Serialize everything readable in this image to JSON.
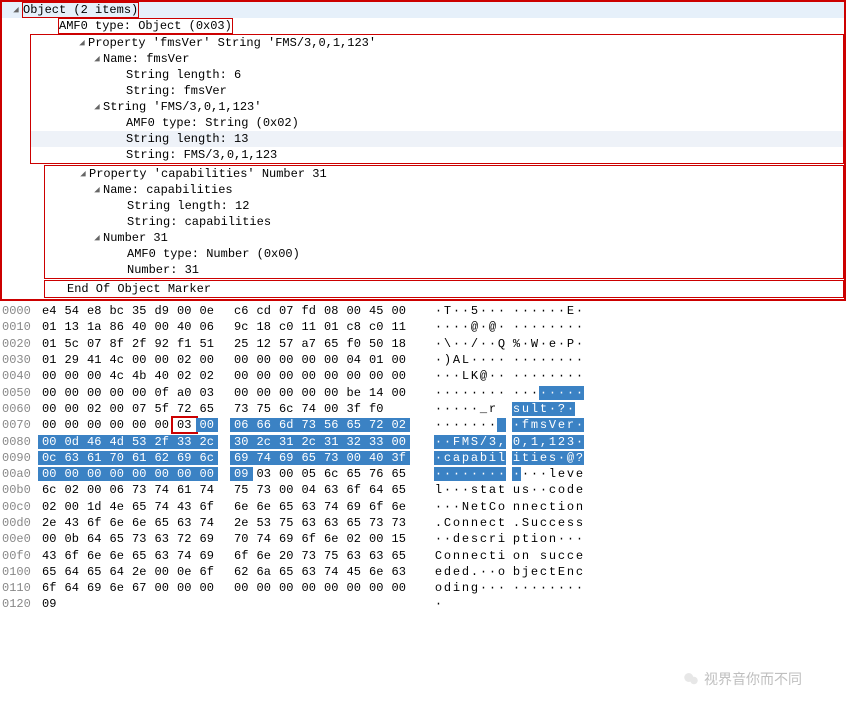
{
  "tree": {
    "root": {
      "label": "Object (2 items)"
    },
    "amf0": {
      "label": "AMF0 type: Object (0x03)"
    },
    "p1": {
      "label": "Property 'fmsVer' String 'FMS/3,0,1,123'",
      "name": {
        "label": "Name: fmsVer",
        "len": "String length: 6",
        "str": "String: fmsVer"
      },
      "val": {
        "label": "String 'FMS/3,0,1,123'",
        "type": "AMF0 type: String (0x02)",
        "len": "String length: 13",
        "str": "String: FMS/3,0,1,123"
      }
    },
    "p2": {
      "label": "Property 'capabilities' Number 31",
      "name": {
        "label": "Name: capabilities",
        "len": "String length: 12",
        "str": "String: capabilities"
      },
      "val": {
        "label": "Number 31",
        "type": "AMF0 type: Number (0x00)",
        "num": "Number: 31"
      }
    },
    "end": {
      "label": "End Of Object Marker"
    }
  },
  "hex": {
    "rows": [
      {
        "off": "0000",
        "b": [
          "e4",
          "54",
          "e8",
          "bc",
          "35",
          "d9",
          "00",
          "0e",
          "c6",
          "cd",
          "07",
          "fd",
          "08",
          "00",
          "45",
          "00"
        ],
        "a": "·T··5··· ······E·"
      },
      {
        "off": "0010",
        "b": [
          "01",
          "13",
          "1a",
          "86",
          "40",
          "00",
          "40",
          "06",
          "9c",
          "18",
          "c0",
          "11",
          "01",
          "c8",
          "c0",
          "11"
        ],
        "a": "····@·@· ········"
      },
      {
        "off": "0020",
        "b": [
          "01",
          "5c",
          "07",
          "8f",
          "2f",
          "92",
          "f1",
          "51",
          "25",
          "12",
          "57",
          "a7",
          "65",
          "f0",
          "50",
          "18"
        ],
        "a": "·\\··/··Q %·W·e·P·"
      },
      {
        "off": "0030",
        "b": [
          "01",
          "29",
          "41",
          "4c",
          "00",
          "00",
          "02",
          "00",
          "00",
          "00",
          "00",
          "00",
          "00",
          "04",
          "01",
          "00"
        ],
        "a": "·)AL···· ········"
      },
      {
        "off": "0040",
        "b": [
          "00",
          "00",
          "00",
          "4c",
          "4b",
          "40",
          "02",
          "02",
          "00",
          "00",
          "00",
          "00",
          "00",
          "00",
          "00",
          "00"
        ],
        "a": "···LK@·· ········"
      },
      {
        "off": "0050",
        "b": [
          "00",
          "00",
          "00",
          "00",
          "00",
          "0f",
          "a0",
          "03",
          "00",
          "00",
          "00",
          "00",
          "00",
          "be",
          "14",
          "00"
        ],
        "a": "········ ········",
        "sel_a": [
          [
            11,
            15
          ]
        ]
      },
      {
        "off": "0060",
        "b": [
          "00",
          "00",
          "02",
          "00",
          "07",
          "5f",
          "72",
          "65",
          "73",
          "75",
          "6c",
          "74",
          "00",
          "3f",
          "f0"
        ],
        "a": "·····_r esult·?·",
        "sel_a": [
          [
            8,
            15
          ]
        ]
      },
      {
        "off": "0070",
        "b": [
          "00",
          "00",
          "00",
          "00",
          "00",
          "00",
          "03",
          "00",
          "06",
          "66",
          "6d",
          "73",
          "56",
          "65",
          "72",
          "02"
        ],
        "box": 6,
        "sel": [
          [
            7,
            15
          ]
        ],
        "a": "·······  ·fmsVer·",
        "sel_a": [
          [
            7,
            15
          ]
        ]
      },
      {
        "off": "0080",
        "b": [
          "00",
          "0d",
          "46",
          "4d",
          "53",
          "2f",
          "33",
          "2c",
          "30",
          "2c",
          "31",
          "2c",
          "31",
          "32",
          "33",
          "00"
        ],
        "sel": [
          [
            0,
            15
          ]
        ],
        "a": "··FMS/3, 0,1,123·",
        "sel_a": [
          [
            0,
            15
          ]
        ]
      },
      {
        "off": "0090",
        "b": [
          "0c",
          "63",
          "61",
          "70",
          "61",
          "62",
          "69",
          "6c",
          "69",
          "74",
          "69",
          "65",
          "73",
          "00",
          "40",
          "3f"
        ],
        "sel": [
          [
            0,
            15
          ]
        ],
        "a": "·capabil ities·@?",
        "sel_a": [
          [
            0,
            15
          ]
        ]
      },
      {
        "off": "00a0",
        "b": [
          "00",
          "00",
          "00",
          "00",
          "00",
          "00",
          "00",
          "00",
          "09",
          "03",
          "00",
          "05",
          "6c",
          "65",
          "76",
          "65"
        ],
        "sel": [
          [
            0,
            8
          ]
        ],
        "a": "········ ····leve",
        "sel_a": [
          [
            0,
            8
          ]
        ]
      },
      {
        "off": "00b0",
        "b": [
          "6c",
          "02",
          "00",
          "06",
          "73",
          "74",
          "61",
          "74",
          "75",
          "73",
          "00",
          "04",
          "63",
          "6f",
          "64",
          "65"
        ],
        "a": "l···stat us··code"
      },
      {
        "off": "00c0",
        "b": [
          "02",
          "00",
          "1d",
          "4e",
          "65",
          "74",
          "43",
          "6f",
          "6e",
          "6e",
          "65",
          "63",
          "74",
          "69",
          "6f",
          "6e"
        ],
        "a": "···NetCo nnection"
      },
      {
        "off": "00d0",
        "b": [
          "2e",
          "43",
          "6f",
          "6e",
          "6e",
          "65",
          "63",
          "74",
          "2e",
          "53",
          "75",
          "63",
          "63",
          "65",
          "73",
          "73"
        ],
        "a": ".Connect .Success"
      },
      {
        "off": "00e0",
        "b": [
          "00",
          "0b",
          "64",
          "65",
          "73",
          "63",
          "72",
          "69",
          "70",
          "74",
          "69",
          "6f",
          "6e",
          "02",
          "00",
          "15"
        ],
        "a": "··descri ption···"
      },
      {
        "off": "00f0",
        "b": [
          "43",
          "6f",
          "6e",
          "6e",
          "65",
          "63",
          "74",
          "69",
          "6f",
          "6e",
          "20",
          "73",
          "75",
          "63",
          "63",
          "65"
        ],
        "a": "Connecti on succe"
      },
      {
        "off": "0100",
        "b": [
          "65",
          "64",
          "65",
          "64",
          "2e",
          "00",
          "0e",
          "6f",
          "62",
          "6a",
          "65",
          "63",
          "74",
          "45",
          "6e",
          "63"
        ],
        "a": "eded.··o bjectEnc"
      },
      {
        "off": "0110",
        "b": [
          "6f",
          "64",
          "69",
          "6e",
          "67",
          "00",
          "00",
          "00",
          "00",
          "00",
          "00",
          "00",
          "00",
          "00",
          "00",
          "00"
        ],
        "a": "oding··· ········"
      },
      {
        "off": "0120",
        "b": [
          "09"
        ],
        "a": "·"
      }
    ]
  },
  "watermark": "视界音你而不同"
}
